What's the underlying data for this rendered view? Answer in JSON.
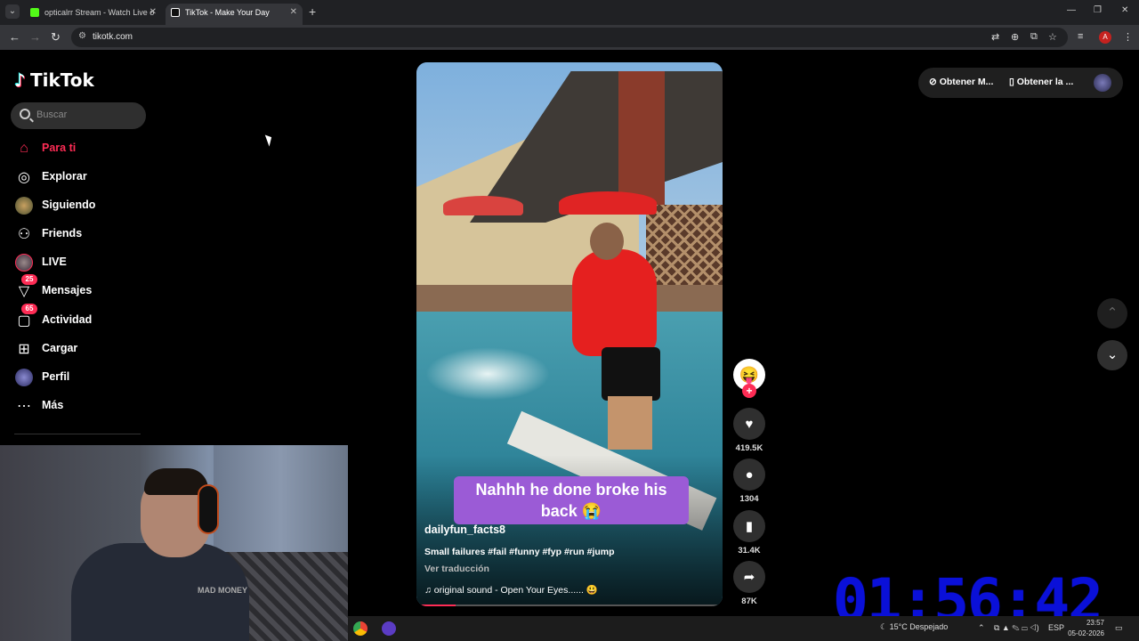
{
  "browser": {
    "tabs": [
      {
        "title": "opticalrr Stream - Watch Live o",
        "favicon_color": "#53fc18"
      },
      {
        "title": "TikTok - Make Your Day",
        "favicon_color": "#ffffff"
      }
    ],
    "url": "tikotk.com",
    "profile_initial": "A"
  },
  "tiktok": {
    "brand": "TikTok",
    "search_placeholder": "Buscar",
    "nav": [
      {
        "label": "Para ti",
        "icon": "home-icon",
        "active": true
      },
      {
        "label": "Explorar",
        "icon": "compass-icon"
      },
      {
        "label": "Siguiendo",
        "icon": "avatar-icon"
      },
      {
        "label": "Friends",
        "icon": "friends-icon"
      },
      {
        "label": "LIVE",
        "icon": "live-avatar-icon"
      },
      {
        "label": "Mensajes",
        "icon": "message-icon",
        "badge": "25"
      },
      {
        "label": "Actividad",
        "icon": "activity-icon",
        "badge": "65"
      },
      {
        "label": "Cargar",
        "icon": "upload-icon"
      },
      {
        "label": "Perfil",
        "icon": "profile-avatar-icon"
      },
      {
        "label": "Más",
        "icon": "more-icon"
      }
    ],
    "header_buttons": [
      "Obtener M...",
      "Obtener la ..."
    ],
    "video": {
      "caption_text": "Nahhh he done broke his back 😭",
      "author": "dailyfun_facts8",
      "description": "Small failures #fail #funny #fyp #run #jump",
      "translate": "Ver traducción",
      "sound": "original sound - Open Your Eyes...... 😃",
      "progress": 0.12
    },
    "actions": {
      "likes": "419.5K",
      "comments": "1304",
      "saves": "31.4K",
      "shares": "87K"
    }
  },
  "overlay": {
    "timer": "01:56:42",
    "shirt_text": "MAD MONEY"
  },
  "taskbar": {
    "weather": "15°C  Despejado",
    "lang": "ESP",
    "time": "23:57",
    "date": "05-02-2026"
  }
}
